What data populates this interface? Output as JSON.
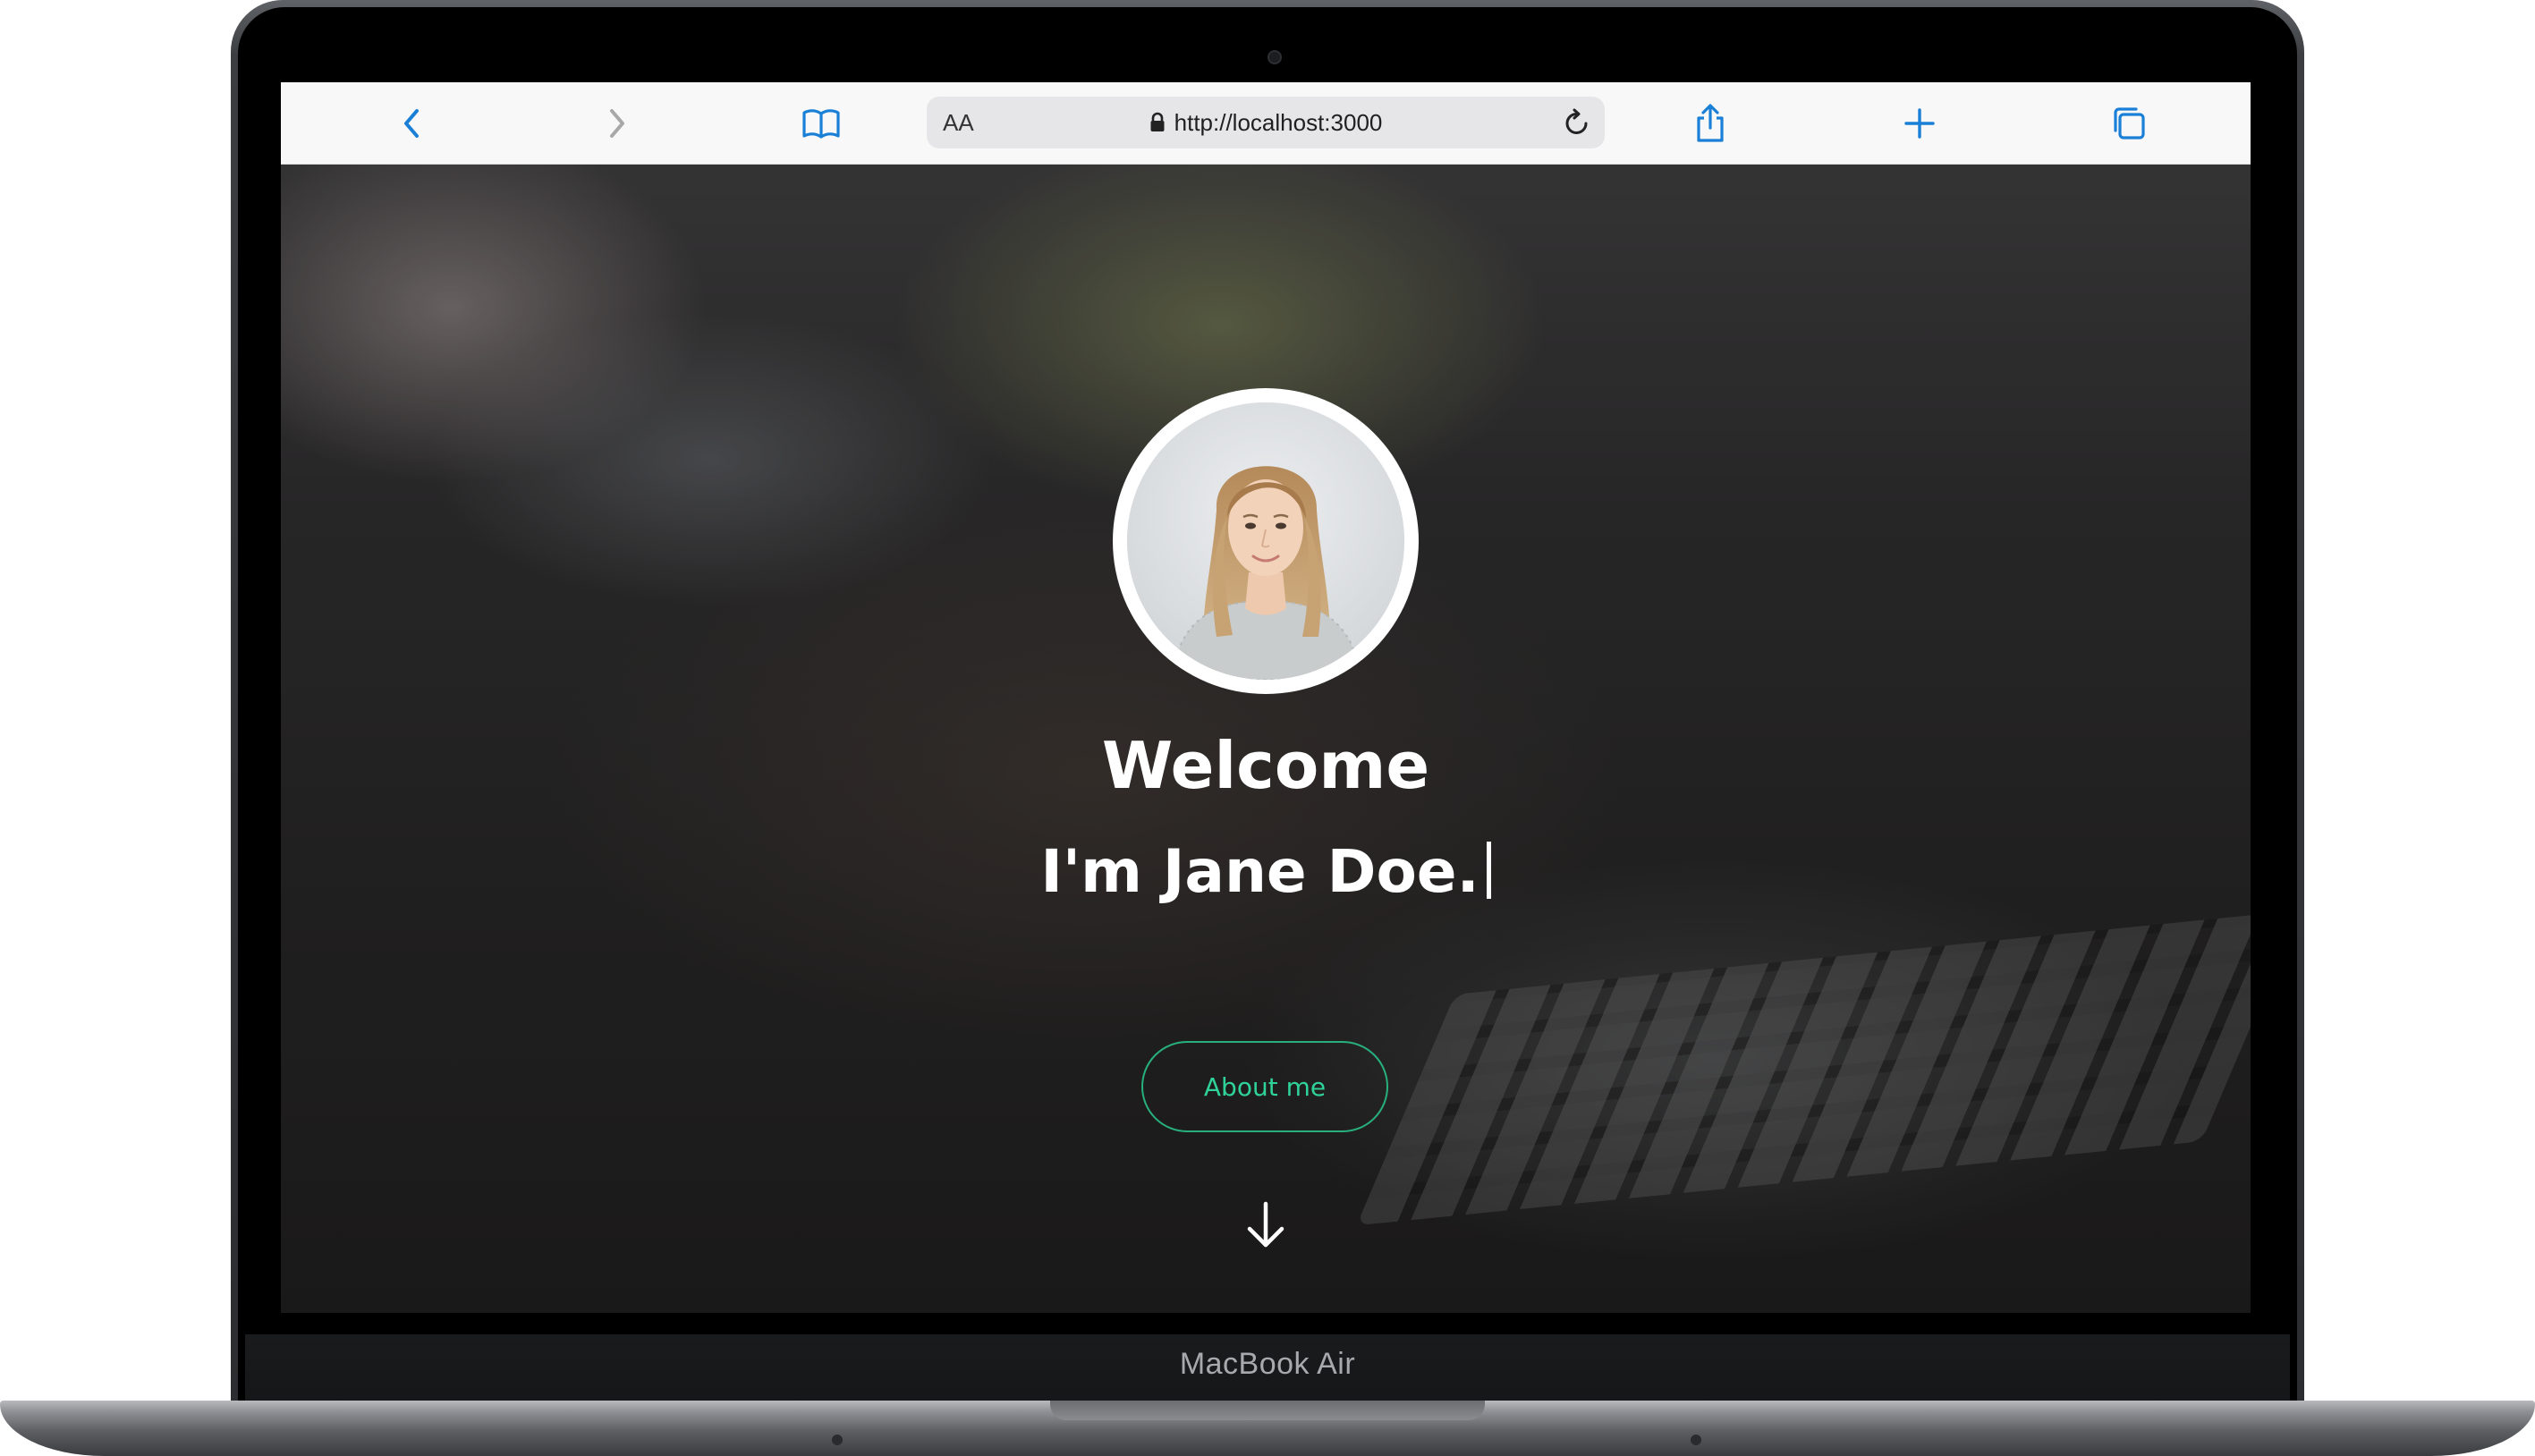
{
  "device": {
    "label": "MacBook Air"
  },
  "browser": {
    "toolbar": {
      "back_icon": "chevron-left-icon",
      "forward_icon": "chevron-right-icon",
      "bookmarks_icon": "book-open-icon",
      "share_icon": "share-icon",
      "new_tab_icon": "plus-icon",
      "tabs_icon": "tabs-icon"
    },
    "address_bar": {
      "text_size_label": "AA",
      "url": "http://localhost:3000",
      "secure": true
    },
    "accent_color": "#1a7fd6"
  },
  "page": {
    "hero": {
      "avatar_alt": "profile photo",
      "title": "Welcome",
      "intro": "I'm Jane Doe.",
      "button_label": "About me",
      "scroll_icon": "arrow-down-icon",
      "accent_color": "#2fd39a"
    }
  }
}
